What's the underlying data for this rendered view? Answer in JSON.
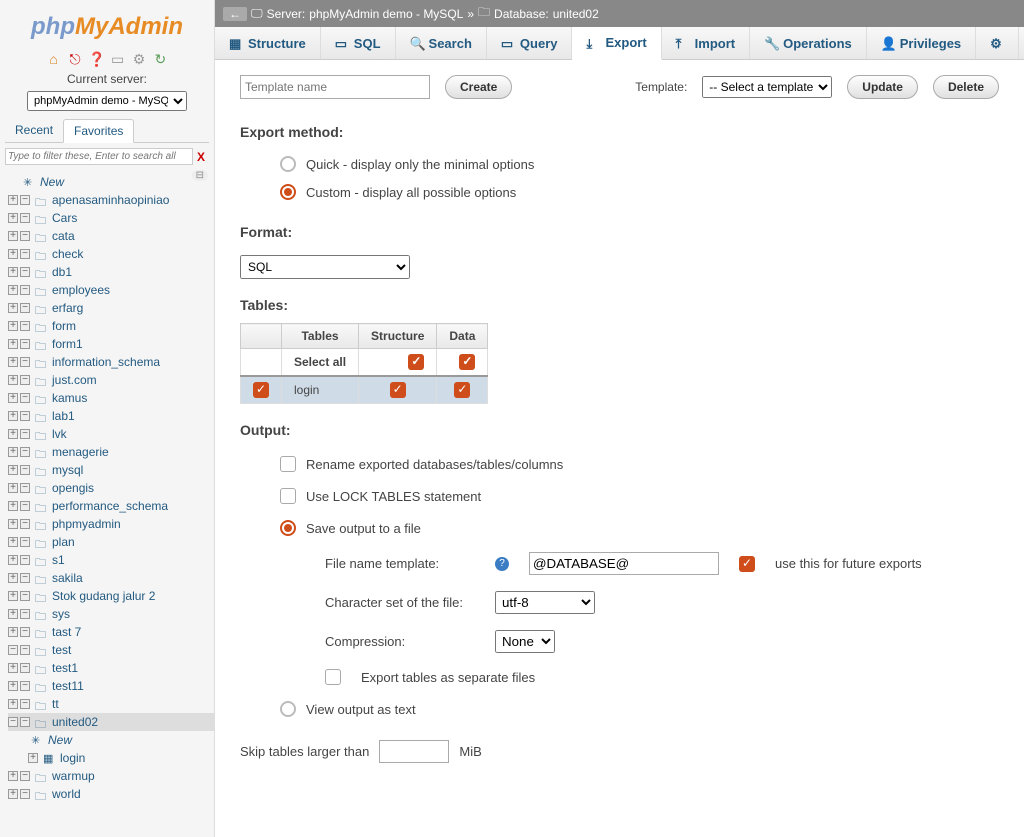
{
  "sidebar": {
    "current_server_label": "Current server:",
    "server_selected": "phpMyAdmin demo - MySQL",
    "tabs": {
      "recent": "Recent",
      "favorites": "Favorites"
    },
    "filter_placeholder": "Type to filter these, Enter to search all",
    "new_label": "New",
    "databases": [
      "apenasaminhaopiniao",
      "Cars",
      "cata",
      "check",
      "db1",
      "employees",
      "erfarg",
      "form",
      "form1",
      "information_schema",
      "just.com",
      "kamus",
      "lab1",
      "lvk",
      "menagerie",
      "mysql",
      "opengis",
      "performance_schema",
      "phpmyadmin",
      "plan",
      "s1",
      "sakila",
      "Stok gudang jalur 2",
      "sys",
      "tast 7",
      "test",
      "test1",
      "test11",
      "tt"
    ],
    "selected_db": "united02",
    "selected_children": {
      "new": "New",
      "table": "login"
    },
    "after_selected": [
      "warmup",
      "world"
    ]
  },
  "breadcrumb": {
    "server_label": "Server:",
    "server": "phpMyAdmin demo - MySQL",
    "db_label": "Database:",
    "db": "united02"
  },
  "tabs": {
    "structure": "Structure",
    "sql": "SQL",
    "search": "Search",
    "query": "Query",
    "export": "Export",
    "import": "Import",
    "operations": "Operations",
    "privileges": "Privileges"
  },
  "templates": {
    "name_placeholder": "Template name",
    "create": "Create",
    "label": "Template:",
    "select_placeholder": "-- Select a template --",
    "update": "Update",
    "delete": "Delete"
  },
  "export_method": {
    "heading": "Export method:",
    "quick": "Quick - display only the minimal options",
    "custom": "Custom - display all possible options"
  },
  "format": {
    "heading": "Format:",
    "selected": "SQL"
  },
  "tables": {
    "heading": "Tables:",
    "col_tables": "Tables",
    "col_structure": "Structure",
    "col_data": "Data",
    "select_all": "Select all",
    "rows": [
      {
        "name": "login"
      }
    ]
  },
  "output": {
    "heading": "Output:",
    "rename": "Rename exported databases/tables/columns",
    "lock_tables_pre": "Use ",
    "lock_tables_code": "LOCK TABLES",
    "lock_tables_post": " statement",
    "save_file": "Save output to a file",
    "filename_label": "File name template:",
    "filename_value": "@DATABASE@",
    "use_future": "use this for future exports",
    "charset_label": "Character set of the file:",
    "charset_value": "utf-8",
    "compression_label": "Compression:",
    "compression_value": "None",
    "separate_files": "Export tables as separate files",
    "view_text": "View output as text",
    "skip_label": "Skip tables larger than",
    "skip_unit": "MiB"
  }
}
